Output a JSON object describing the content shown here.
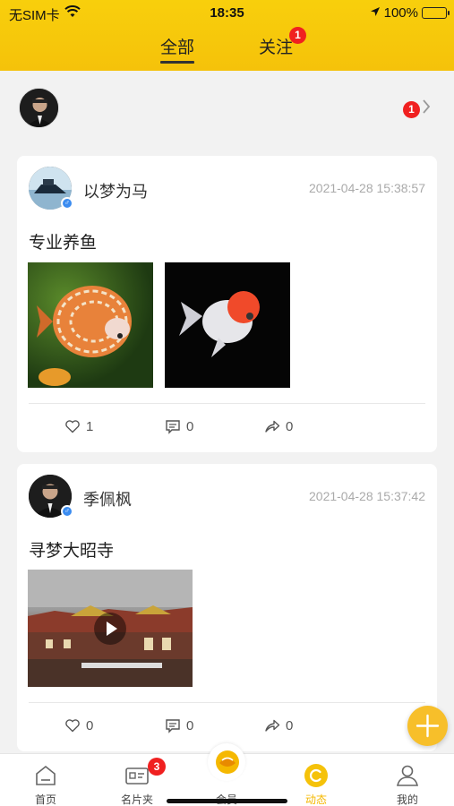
{
  "status_bar": {
    "carrier": "无SIM卡",
    "time": "18:35",
    "battery": "100%"
  },
  "tabs": {
    "all": "全部",
    "follow": "关注",
    "follow_badge": "1"
  },
  "user_row": {
    "badge": "1"
  },
  "posts": [
    {
      "name": "以梦为马",
      "time": "2021-04-28 15:38:57",
      "text": "专业养鱼",
      "likes": "1",
      "comments": "0",
      "shares": "0"
    },
    {
      "name": "季佩枫",
      "time": "2021-04-28 15:37:42",
      "text": "寻梦大昭寺",
      "likes": "0",
      "comments": "0",
      "shares": "0"
    }
  ],
  "tabbar": {
    "home": "首页",
    "cards": "名片夹",
    "cards_badge": "3",
    "vip": "会员",
    "feed": "动态",
    "me": "我的"
  },
  "colors": {
    "accent": "#f5c20a",
    "badge": "#f02020",
    "active_tab": "#f5b800",
    "gender": "#3b8cf0"
  },
  "icons": [
    "wifi-icon",
    "location-icon",
    "battery-icon",
    "chevron-right-icon",
    "heart-icon",
    "comment-icon",
    "share-icon",
    "plus-icon",
    "home-icon",
    "card-icon",
    "vip-icon",
    "feed-icon",
    "user-icon",
    "play-icon"
  ]
}
